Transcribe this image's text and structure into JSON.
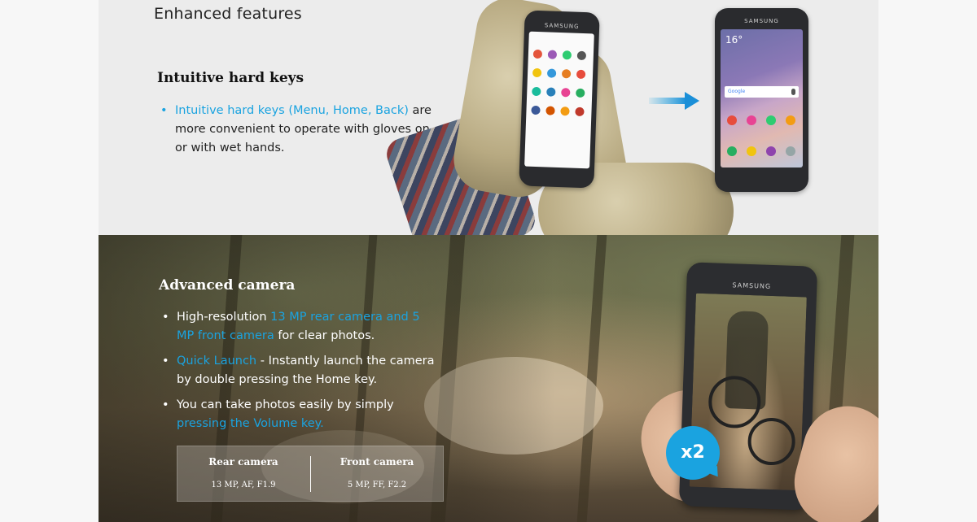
{
  "top": {
    "title": "Enhanced features",
    "heading": "Intuitive hard keys",
    "bullet_lead": "Intuitive hard keys (Menu, Home, Back)",
    "bullet_rest": "are more convenient to operate with gloves on or with wet hands."
  },
  "phones": {
    "brand": "SAMSUNG",
    "clock": "16",
    "google": "Google"
  },
  "camera": {
    "heading": "Advanced camera",
    "bullets": [
      {
        "plain1": "High-resolution ",
        "blue": "13 MP rear camera and 5 MP front camera",
        "plain2": " for clear photos."
      },
      {
        "blue": "Quick Launch",
        "plain2": " - Instantly launch the camera by double pressing the Home key."
      },
      {
        "plain1": "You can take photos easily by simply ",
        "blue": "pressing the Volume key."
      }
    ],
    "specs": [
      {
        "title": "Rear camera",
        "value": "13 MP, AF, F1.9"
      },
      {
        "title": "Front camera",
        "value": "5 MP, FF, F2.2"
      }
    ],
    "badge": "x2"
  },
  "colors": {
    "accent": "#1aa3e0"
  }
}
